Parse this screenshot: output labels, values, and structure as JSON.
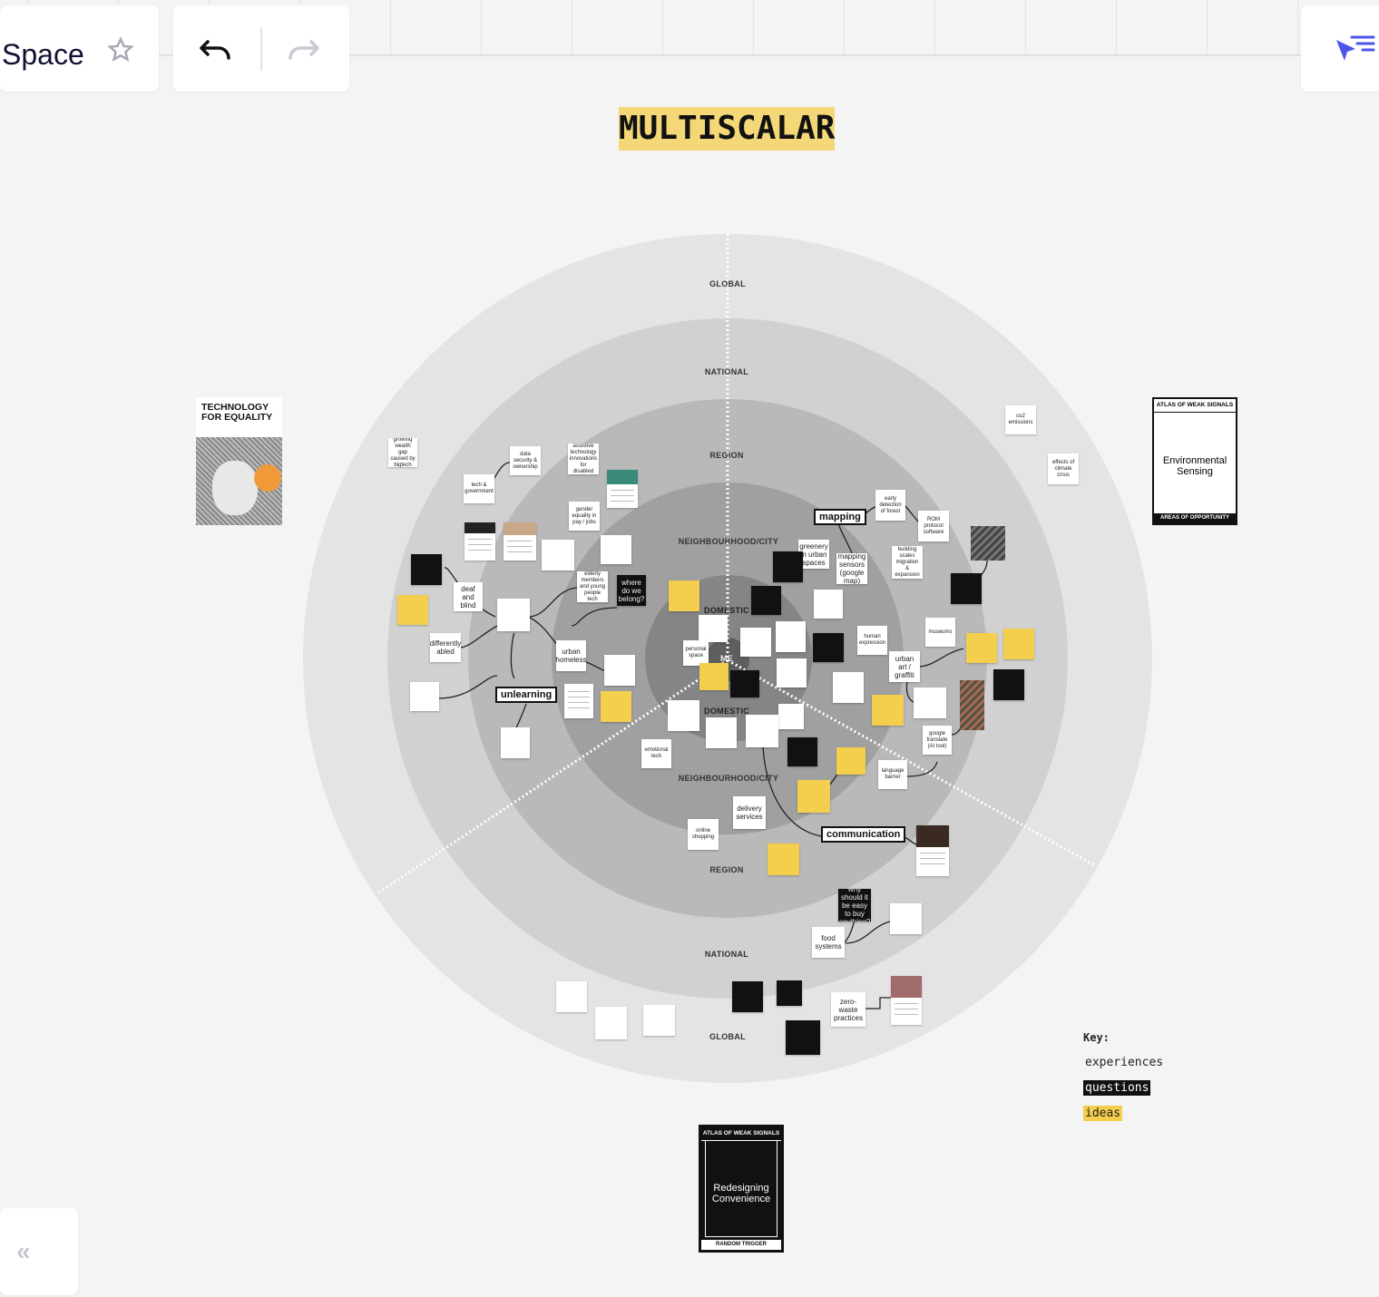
{
  "header": {
    "space_title": "Space",
    "favorite_icon": "star-icon",
    "undo_icon": "undo-icon",
    "redo_icon": "redo-icon",
    "select_tool_icon": "cursor-icon"
  },
  "sidebar": {
    "collapse_label": "«"
  },
  "board": {
    "title": "MULTISCALAR",
    "ring_labels": {
      "global_top": "GLOBAL",
      "national_top": "NATIONAL",
      "region_top": "REGION",
      "neighbourhood_top": "NEIGHBOURHOOD/CITY",
      "domestic_top": "DOMESTIC",
      "me": "ME",
      "domestic_bottom": "DOMESTIC",
      "neighbourhood_bottom": "NEIGHBOURHOOD/CITY",
      "region_bottom": "REGION",
      "national_bottom": "NATIONAL",
      "global_bottom": "GLOBAL"
    },
    "tags": {
      "mapping": "mapping",
      "unlearning": "unlearning",
      "communication": "communication"
    },
    "cards": {
      "technology_for_equality": "TECHNOLOGY FOR EQUALITY",
      "environmental_sensing": {
        "head": "ATLAS OF WEAK SIGNALS",
        "title": "Environmental Sensing",
        "foot": "AREAS OF OPPORTUNITY"
      },
      "redesigning_convenience": {
        "head": "ATLAS OF WEAK SIGNALS",
        "title": "Redesigning Convenience",
        "foot": "RANDOM TRIGGER"
      }
    },
    "notes": {
      "wealth_gap": "growing wealth gap caused by bigtech",
      "data_security": "data security & ownership",
      "assistive_tech": "assistive technology innovations for disabled",
      "tech_government": "tech & government",
      "gender_equality": "gender equality in pay / jobs",
      "deaf_blind": "deaf and blind",
      "elderly": "elderly members and young people tech",
      "where_belong": "where do we belong?",
      "differently_abled": "differently abled",
      "urban_homeless": "urban homeless",
      "unlearning_note": "unlearning",
      "greenery": "greenery in urban spaces",
      "mapping_sensors": "mapping sensors (google map)",
      "early_detection": "early detection of forest",
      "rom_protocols": "ROM protocol software",
      "building_scales": "building scales migration & expansion",
      "personal_space": "personal space",
      "human_expression": "human expression",
      "museums": "museums",
      "urban_art": "urban art / graffiti",
      "language_barrier": "language barrier",
      "google_translate": "google translate (AI tool)",
      "delivery_services": "delivery services",
      "online_shopping": "online shopping",
      "food_systems": "food systems",
      "zero_waste": "zero-waste practices",
      "why_buy": "why should it be easy to buy anything?",
      "co2": "co2 emissions",
      "climate_crisis": "effects of climate crisis",
      "emotional_tech": "emotional tech"
    }
  },
  "key": {
    "title": "Key:",
    "experiences": "experiences",
    "questions": "questions",
    "ideas": "ideas"
  }
}
